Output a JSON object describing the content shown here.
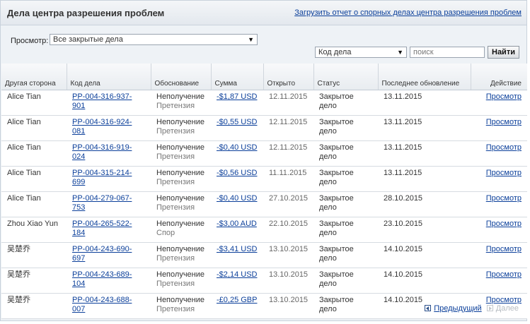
{
  "header": {
    "title": "Дела центра разрешения проблем",
    "download_link": "Загрузить отчет о спорных делах центра разрешения проблем"
  },
  "filters": {
    "view_label": "Просмотр:",
    "view_value": "Все закрытые дела",
    "search_field_value": "Код дела",
    "search_placeholder": "поиск",
    "find_button": "Найти"
  },
  "table": {
    "columns": {
      "party": "Другая сторона",
      "code": "Код дела",
      "reason": "Обоснование",
      "amount": "Сумма",
      "opened": "Открыто",
      "status": "Статус",
      "updated": "Последнее обновление",
      "action": "Действие"
    },
    "rows": [
      {
        "party": "Alice Tian",
        "code_1": "PP-004-316-937-",
        "code_2": "901",
        "reason_1": "Неполучение",
        "reason_2": "Претензия",
        "amount": "-$1,87 USD",
        "opened": "12.11.2015",
        "status_1": "Закрытое",
        "status_2": "дело",
        "updated": "13.11.2015",
        "action": "Просмотр"
      },
      {
        "party": "Alice Tian",
        "code_1": "PP-004-316-924-",
        "code_2": "081",
        "reason_1": "Неполучение",
        "reason_2": "Претензия",
        "amount": "-$0,55 USD",
        "opened": "12.11.2015",
        "status_1": "Закрытое",
        "status_2": "дело",
        "updated": "13.11.2015",
        "action": "Просмотр"
      },
      {
        "party": "Alice Tian",
        "code_1": "PP-004-316-919-",
        "code_2": "024",
        "reason_1": "Неполучение",
        "reason_2": "Претензия",
        "amount": "-$0,40 USD",
        "opened": "12.11.2015",
        "status_1": "Закрытое",
        "status_2": "дело",
        "updated": "13.11.2015",
        "action": "Просмотр"
      },
      {
        "party": "Alice Tian",
        "code_1": "PP-004-315-214-",
        "code_2": "699",
        "reason_1": "Неполучение",
        "reason_2": "Претензия",
        "amount": "-$0,56 USD",
        "opened": "11.11.2015",
        "status_1": "Закрытое",
        "status_2": "дело",
        "updated": "13.11.2015",
        "action": "Просмотр"
      },
      {
        "party": "Alice Tian",
        "code_1": "PP-004-279-067-",
        "code_2": "753",
        "reason_1": "Неполучение",
        "reason_2": "Претензия",
        "amount": "-$0,40 USD",
        "opened": "27.10.2015",
        "status_1": "Закрытое",
        "status_2": "дело",
        "updated": "28.10.2015",
        "action": "Просмотр"
      },
      {
        "party": "Zhou Xiao Yun",
        "code_1": "PP-004-265-522-",
        "code_2": "184",
        "reason_1": "Неполучение",
        "reason_2": "Спор",
        "amount": "-$3,00 AUD",
        "opened": "22.10.2015",
        "status_1": "Закрытое",
        "status_2": "дело",
        "updated": "23.10.2015",
        "action": "Просмотр"
      },
      {
        "party": "吴楚乔",
        "code_1": "PP-004-243-690-",
        "code_2": "697",
        "reason_1": "Неполучение",
        "reason_2": "Претензия",
        "amount": "-$3,41 USD",
        "opened": "13.10.2015",
        "status_1": "Закрытое",
        "status_2": "дело",
        "updated": "14.10.2015",
        "action": "Просмотр"
      },
      {
        "party": "吴楚乔",
        "code_1": "PP-004-243-689-",
        "code_2": "104",
        "reason_1": "Неполучение",
        "reason_2": "Претензия",
        "amount": "-$2,14 USD",
        "opened": "13.10.2015",
        "status_1": "Закрытое",
        "status_2": "дело",
        "updated": "14.10.2015",
        "action": "Просмотр"
      },
      {
        "party": "吴楚乔",
        "code_1": "PP-004-243-688-",
        "code_2": "007",
        "reason_1": "Неполучение",
        "reason_2": "Претензия",
        "amount": "-£0,25 GBP",
        "opened": "13.10.2015",
        "status_1": "Закрытое",
        "status_2": "дело",
        "updated": "14.10.2015",
        "action": "Просмотр"
      }
    ]
  },
  "pager": {
    "prev": "Предыдущий",
    "next": "Далее"
  },
  "icons": {
    "dropdown": "chevron-down-icon",
    "prev": "prev-page-icon",
    "next": "next-page-icon"
  },
  "colors": {
    "link": "#0b3f9a",
    "panel_background": "#eef2f6",
    "disabled": "#b7bcc2"
  }
}
